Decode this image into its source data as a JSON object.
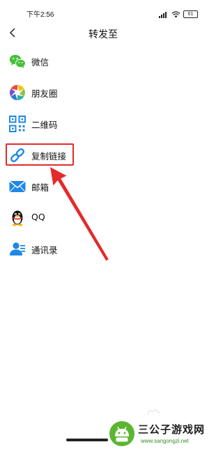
{
  "status_bar": {
    "time": "下午2:56",
    "battery": "61"
  },
  "header": {
    "title": "转发至"
  },
  "share_targets": [
    {
      "label": "微信",
      "icon": "wechat-icon"
    },
    {
      "label": "朋友圈",
      "icon": "moments-icon"
    },
    {
      "label": "二维码",
      "icon": "qr-code-icon"
    },
    {
      "label": "复制链接",
      "icon": "link-icon"
    },
    {
      "label": "邮箱",
      "icon": "mail-icon"
    },
    {
      "label": "QQ",
      "icon": "qq-penguin-icon"
    },
    {
      "label": "通讯录",
      "icon": "contacts-icon"
    }
  ],
  "highlighted_item": "复制链接",
  "colors": {
    "accent": "#1e88e5",
    "wechat_green": "#46c13b",
    "highlight_red": "#e42a2a"
  },
  "watermark": {
    "title": "三公子游戏网",
    "url": "www.sangongzi.net"
  }
}
